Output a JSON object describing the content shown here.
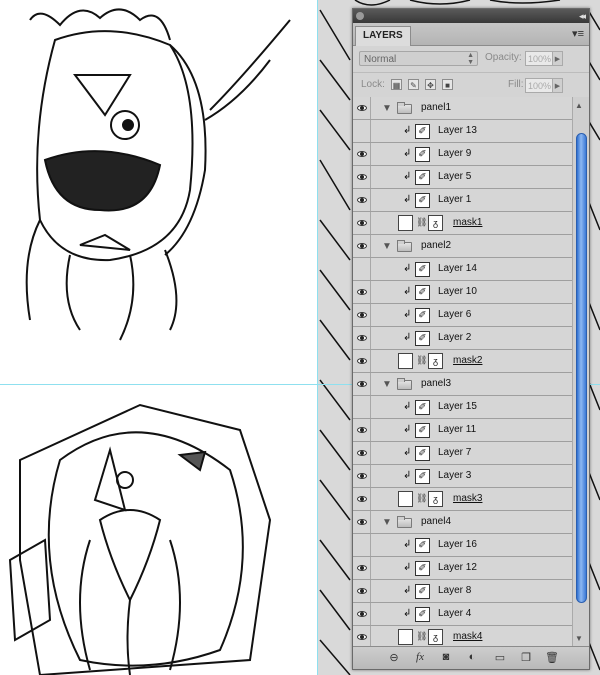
{
  "panel": {
    "tab_title": "LAYERS",
    "blend_mode": "Normal",
    "opacity_label": "Opacity:",
    "opacity_value": "100%",
    "lock_label": "Lock:",
    "fill_label": "Fill:",
    "fill_value": "100%"
  },
  "layers": [
    {
      "kind": "group",
      "name": "panel1",
      "visible": true
    },
    {
      "kind": "layer",
      "name": "Layer 13",
      "visible": false
    },
    {
      "kind": "layer",
      "name": "Layer 9",
      "visible": true
    },
    {
      "kind": "layer",
      "name": "Layer 5",
      "visible": true
    },
    {
      "kind": "layer",
      "name": "Layer 1",
      "visible": true
    },
    {
      "kind": "mask",
      "name": "mask1",
      "visible": true
    },
    {
      "kind": "group",
      "name": "panel2",
      "visible": true
    },
    {
      "kind": "layer",
      "name": "Layer 14",
      "visible": false
    },
    {
      "kind": "layer",
      "name": "Layer 10",
      "visible": true
    },
    {
      "kind": "layer",
      "name": "Layer 6",
      "visible": true
    },
    {
      "kind": "layer",
      "name": "Layer 2",
      "visible": true
    },
    {
      "kind": "mask",
      "name": "mask2",
      "visible": true
    },
    {
      "kind": "group",
      "name": "panel3",
      "visible": true
    },
    {
      "kind": "layer",
      "name": "Layer 15",
      "visible": false
    },
    {
      "kind": "layer",
      "name": "Layer 11",
      "visible": true
    },
    {
      "kind": "layer",
      "name": "Layer 7",
      "visible": true
    },
    {
      "kind": "layer",
      "name": "Layer 3",
      "visible": true
    },
    {
      "kind": "mask",
      "name": "mask3",
      "visible": true
    },
    {
      "kind": "group",
      "name": "panel4",
      "visible": true
    },
    {
      "kind": "layer",
      "name": "Layer 16",
      "visible": false
    },
    {
      "kind": "layer",
      "name": "Layer 12",
      "visible": true
    },
    {
      "kind": "layer",
      "name": "Layer 8",
      "visible": true
    },
    {
      "kind": "layer",
      "name": "Layer 4",
      "visible": true
    },
    {
      "kind": "mask",
      "name": "mask4",
      "visible": true
    }
  ],
  "footer_icons": [
    "link-layers-icon",
    "fx-icon",
    "add-mask-icon",
    "adjustment-layer-icon",
    "new-group-icon",
    "new-layer-icon",
    "trash-icon"
  ]
}
